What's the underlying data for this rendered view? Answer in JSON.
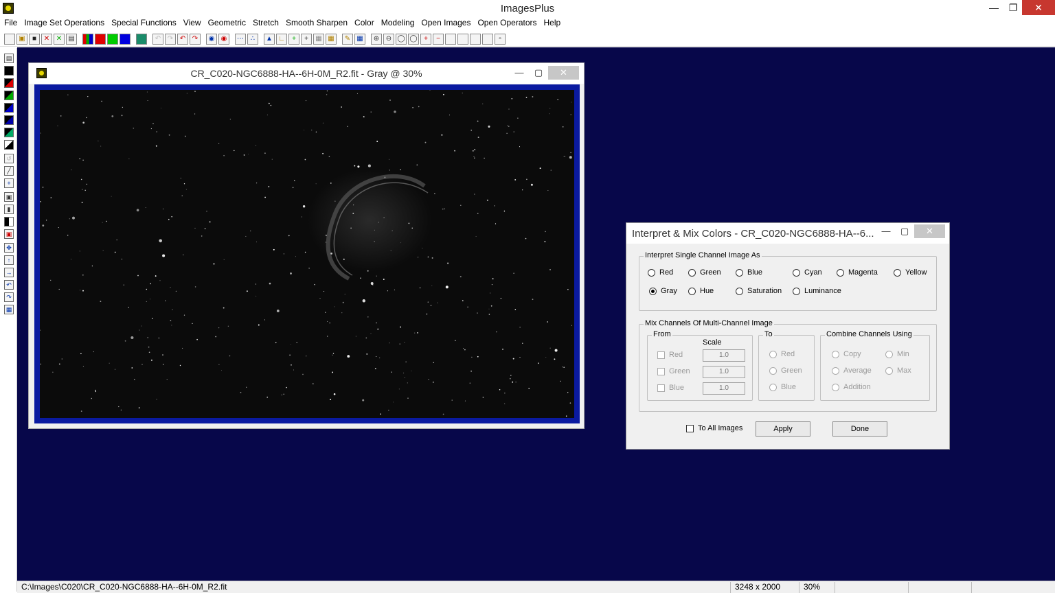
{
  "app": {
    "title": "ImagesPlus"
  },
  "menu": [
    "File",
    "Image Set Operations",
    "Special Functions",
    "View",
    "Geometric",
    "Stretch",
    "Smooth Sharpen",
    "Color",
    "Modeling",
    "Open Images",
    "Open Operators",
    "Help"
  ],
  "image_window": {
    "title": "CR_C020-NGC6888-HA--6H-0M_R2.fit - Gray @ 30%"
  },
  "dialog": {
    "title": "Interpret & Mix Colors - CR_C020-NGC6888-HA--6...",
    "interpret_group": {
      "label": "Interpret Single Channel Image As",
      "options": [
        "Red",
        "Green",
        "Blue",
        "Cyan",
        "Magenta",
        "Yellow",
        "Gray",
        "Hue",
        "Saturation",
        "Luminance"
      ],
      "selected": "Gray"
    },
    "mix_group": {
      "label": "Mix Channels Of Multi-Channel Image",
      "from_label": "From",
      "scale_label": "Scale",
      "from_channels": [
        {
          "name": "Red",
          "scale": "1.0"
        },
        {
          "name": "Green",
          "scale": "1.0"
        },
        {
          "name": "Blue",
          "scale": "1.0"
        }
      ],
      "to_label": "To",
      "to_channels": [
        "Red",
        "Green",
        "Blue"
      ],
      "combine_label": "Combine Channels Using",
      "combine_options": [
        "Copy",
        "Min",
        "Average",
        "Max",
        "Addition"
      ]
    },
    "to_all_images_label": "To All Images",
    "apply_label": "Apply",
    "done_label": "Done"
  },
  "status": {
    "path": "C:\\Images\\C020\\CR_C020-NGC6888-HA--6H-0M_R2.fit",
    "dimensions": "3248 x 2000",
    "zoom": "30%"
  }
}
